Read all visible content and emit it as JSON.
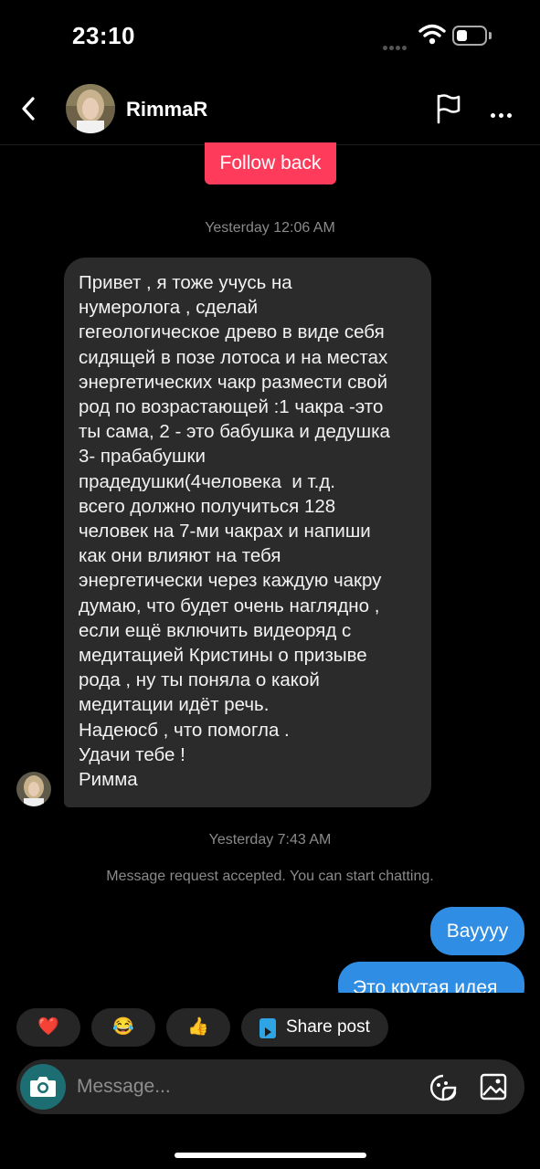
{
  "status_bar": {
    "time": "23:10",
    "battery_level": 0.4
  },
  "header": {
    "username": "RimmaR"
  },
  "follow_back": "Follow back",
  "timestamps": {
    "first": "Yesterday 12:06 AM",
    "second": "Yesterday 7:43 AM"
  },
  "incoming_message": "Привет , я тоже учусь на\nнумеролога , сделай\nгегеологическое древо в виде себя\nсидящей в позе лотоса и на местах\nэнергетических чакр размести свой\nрод по возрастающей :1 чакра -это\nты сама, 2 - это бабушка и дедушка\n3- прабабушки\nпрадедушки(4человека  и т.д.\nвсего должно получиться 128\nчеловек на 7-ми чакрах и напиши\nкак они влияют на тебя\nэнергетически через каждую чакру\nдумаю, что будет очень наглядно ,\nесли ещё включить видеоряд с\nмедитацией Кристины о призыве\nрода , ну ты поняла о какой\nмедитации идёт речь.\nНадеюсб , что помогла .\nУдачи тебе !\nРимма",
  "system_message": "Message request accepted. You can start chatting.",
  "outgoing_messages": [
    "Вауууу",
    "Это крутая идея"
  ],
  "quick_reactions": {
    "heart": "❤️",
    "laugh": "😂",
    "thumbs_up": "👍",
    "share_label": "Share post"
  },
  "composer": {
    "placeholder": "Message..."
  },
  "colors": {
    "follow_button": "#ff3b5c",
    "outgoing_bubble": "#2f8de4",
    "incoming_bubble": "#2b2b2b",
    "camera_button": "#1d6e73"
  }
}
